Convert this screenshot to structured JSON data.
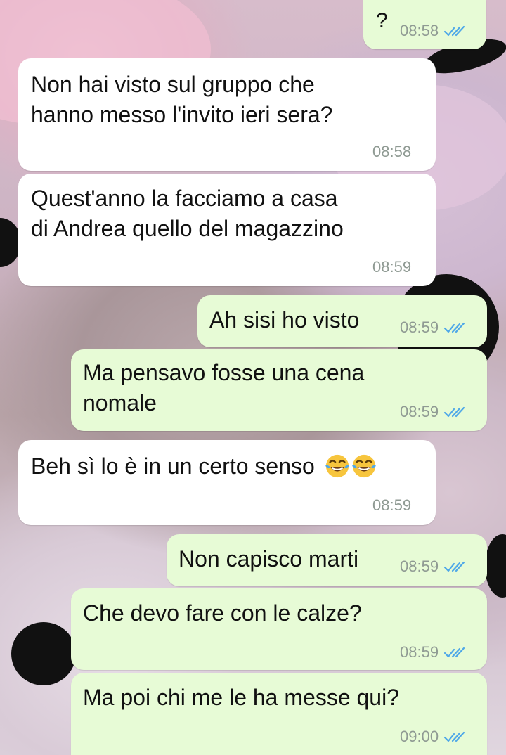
{
  "chat": {
    "messages": [
      {
        "id": "m1",
        "direction": "out",
        "text": "?",
        "time": "08:58",
        "status": "read"
      },
      {
        "id": "m2",
        "direction": "in",
        "text": "Non hai visto sul gruppo che\nhanno messo l'invito ieri sera?",
        "time": "08:58"
      },
      {
        "id": "m3",
        "direction": "in",
        "text": "Quest'anno la facciamo a casa\ndi Andrea quello del magazzino",
        "time": "08:59"
      },
      {
        "id": "m4",
        "direction": "out",
        "text": "Ah sisi ho visto",
        "time": "08:59",
        "status": "read"
      },
      {
        "id": "m5",
        "direction": "out",
        "text": "Ma pensavo fosse una cena\nnomale",
        "time": "08:59",
        "status": "read"
      },
      {
        "id": "m6",
        "direction": "in",
        "text": "Beh sì lo è in un certo senso",
        "emojis": [
          "face-with-tears-of-joy",
          "face-with-tears-of-joy"
        ],
        "time": "08:59"
      },
      {
        "id": "m7",
        "direction": "out",
        "text": "Non capisco marti",
        "time": "08:59",
        "status": "read"
      },
      {
        "id": "m8",
        "direction": "out",
        "text": "Che devo fare con le calze?",
        "time": "08:59",
        "status": "read"
      },
      {
        "id": "m9",
        "direction": "out",
        "text": "Ma poi chi me le ha messe qui?",
        "time": "09:00",
        "status": "read"
      }
    ]
  },
  "colors": {
    "incoming_bubble": "#ffffff",
    "outgoing_bubble": "#e7fbd6",
    "read_ticks": "#4fa8e8",
    "meta_text": "#8f9a93"
  }
}
